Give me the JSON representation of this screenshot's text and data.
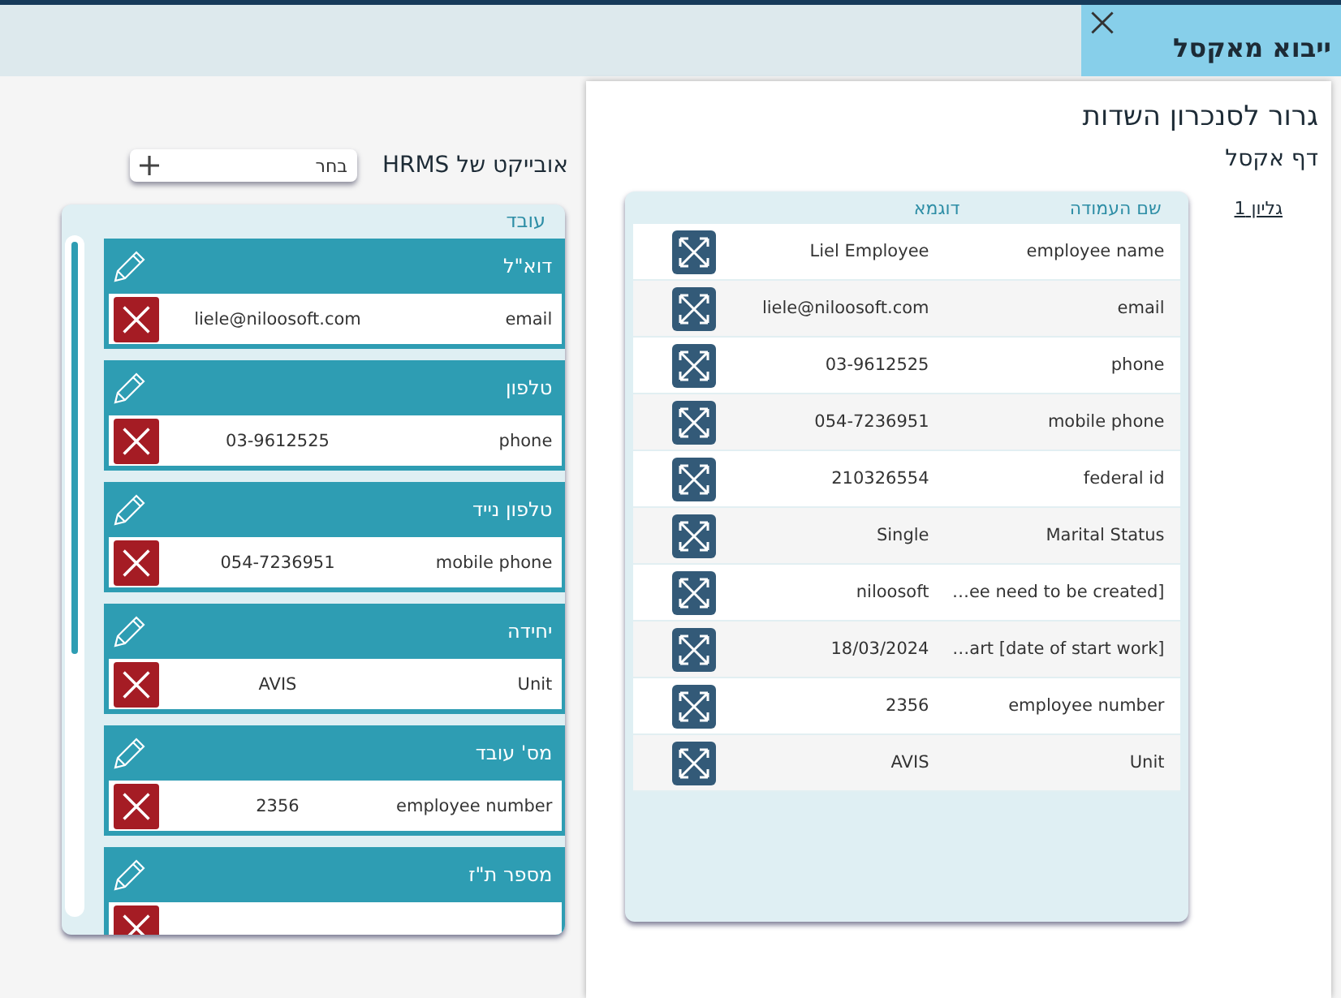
{
  "dialog": {
    "title": "ייבוא מאקסל"
  },
  "left": {
    "title": "אובייקט של HRMS",
    "select": {
      "value": "בחר"
    },
    "card_title": "עובד",
    "groups": [
      {
        "label": "דוא\"ל",
        "field": "email",
        "value": "liele@niloosoft.com"
      },
      {
        "label": "טלפון",
        "field": "phone",
        "value": "03-9612525"
      },
      {
        "label": "טלפון נייד",
        "field": "mobile phone",
        "value": "054-7236951"
      },
      {
        "label": "יחידה",
        "field": "Unit",
        "value": "AVIS"
      },
      {
        "label": "מס' עובד",
        "field": "employee number",
        "value": "2356"
      },
      {
        "label": "מספר ת\"ז"
      }
    ]
  },
  "right": {
    "heading": "גרור לסנכרון השדות",
    "subheading": "דף אקסל",
    "sheet_link": "גליון 1",
    "columns": [
      "שם העמודה",
      "דוגמא"
    ],
    "rows": [
      {
        "name": "employee name",
        "example": "Liel Employee"
      },
      {
        "name": "email",
        "example": "liele@niloosoft.com"
      },
      {
        "name": "phone",
        "example": "03-9612525"
      },
      {
        "name": "mobile phone",
        "example": "054-7236951"
      },
      {
        "name": "federal id",
        "example": "210326554"
      },
      {
        "name": "Marital Status",
        "example": "Single"
      },
      {
        "name": "…ee need to be created]",
        "example": "niloosoft"
      },
      {
        "name": "…art [date of start work]",
        "example": "18/03/2024"
      },
      {
        "name": "employee number",
        "example": "2356"
      },
      {
        "name": "Unit",
        "example": "AVIS"
      }
    ]
  }
}
